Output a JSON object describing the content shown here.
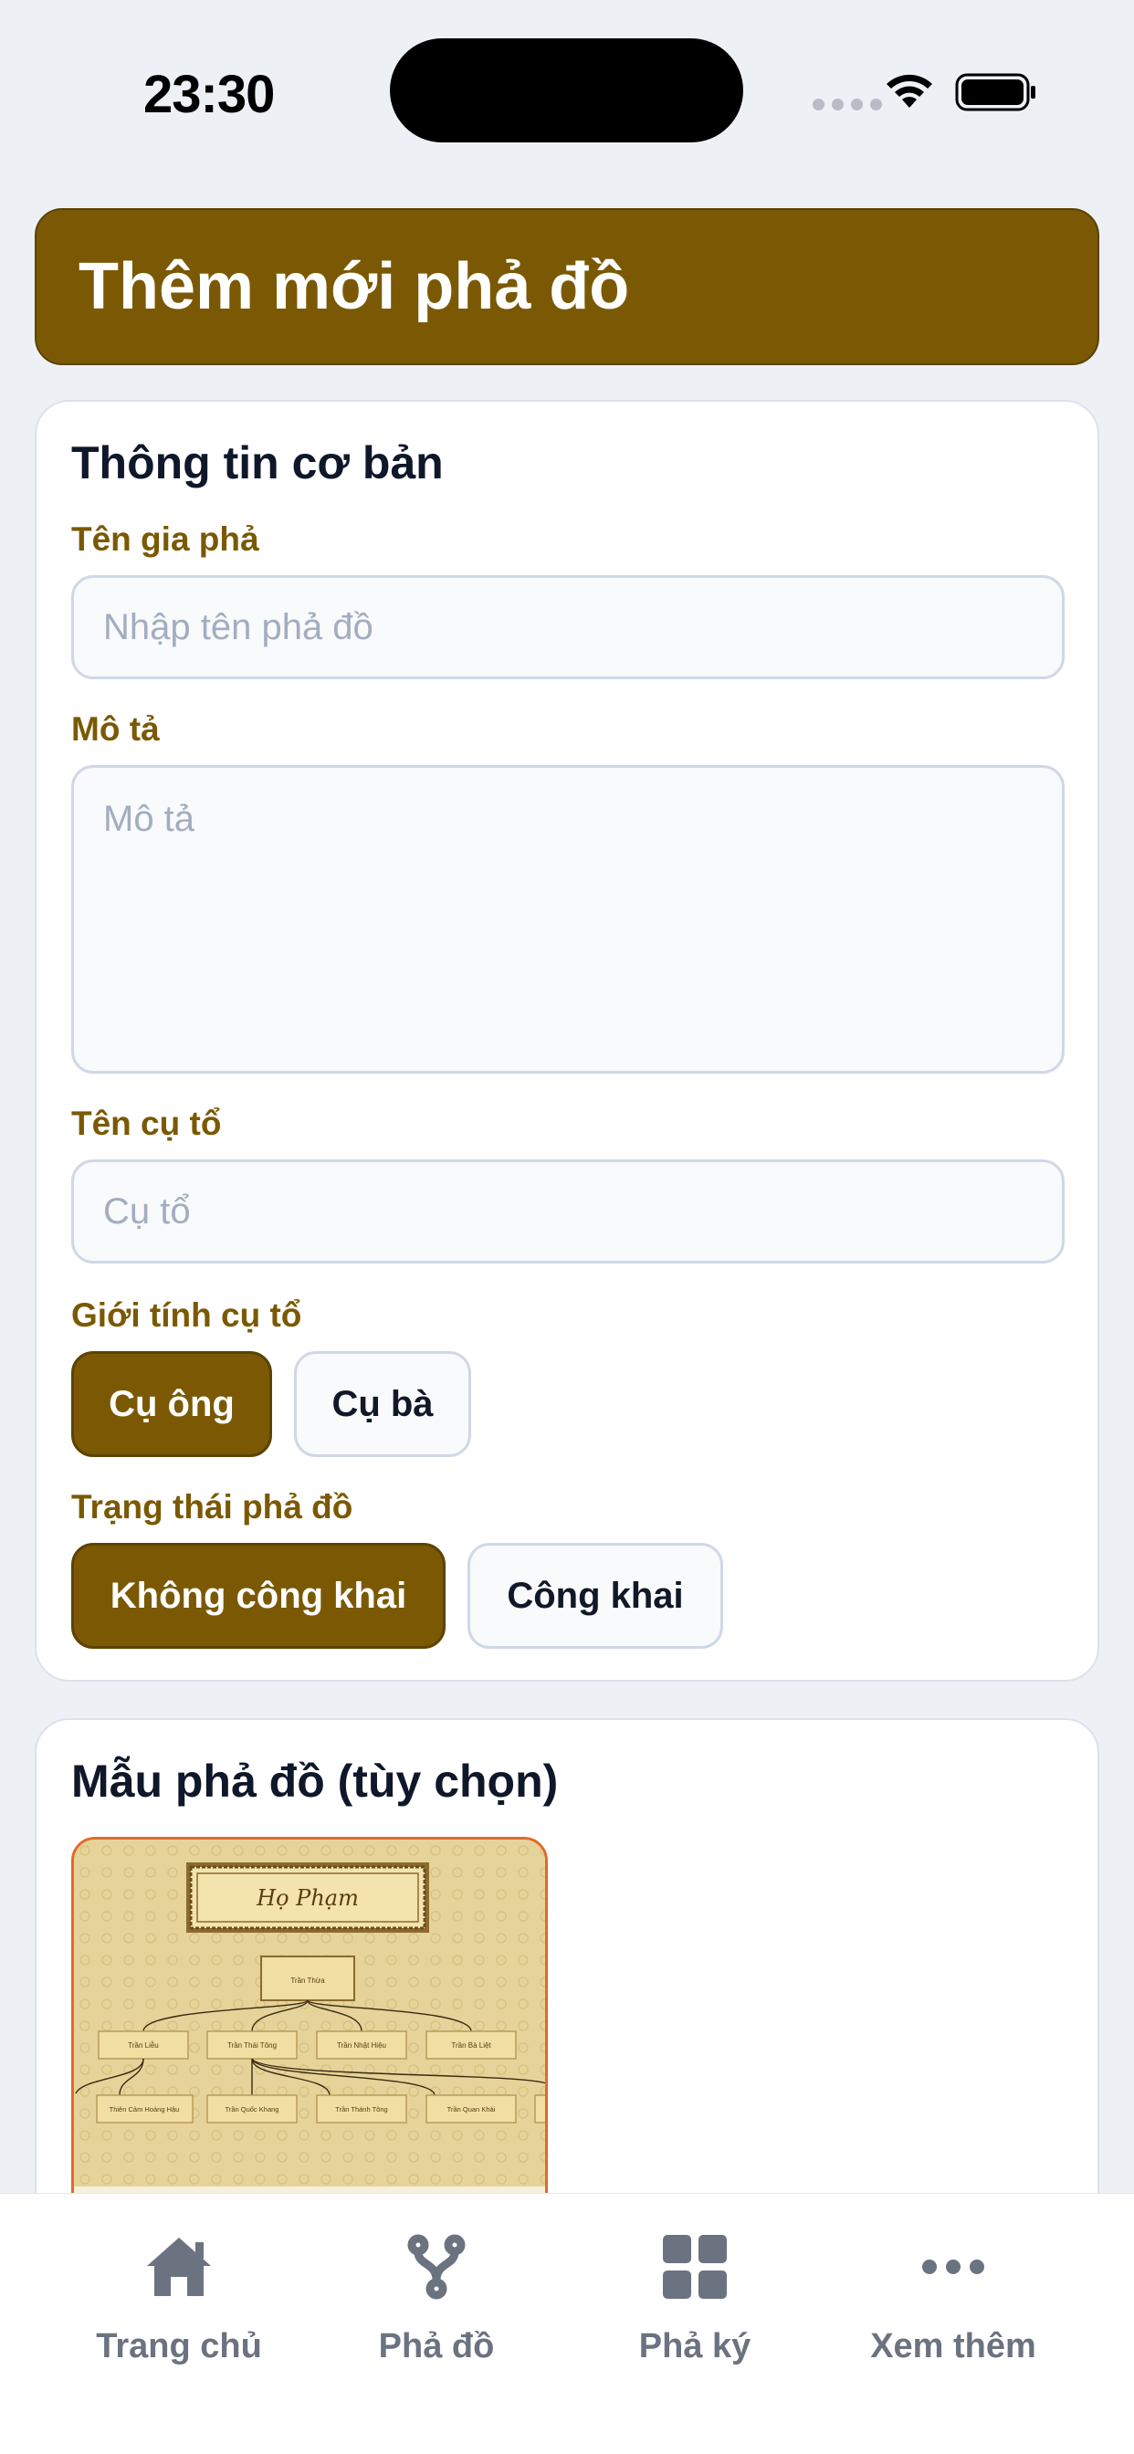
{
  "status": {
    "time": "23:30"
  },
  "header": {
    "title": "Thêm mới phả đồ"
  },
  "basic_info": {
    "title": "Thông tin cơ bản",
    "name_label": "Tên gia phả",
    "name_placeholder": "Nhập tên phả đồ",
    "desc_label": "Mô tả",
    "desc_placeholder": "Mô tả",
    "ancestor_label": "Tên cụ tổ",
    "ancestor_placeholder": "Cụ tổ",
    "gender_label": "Giới tính cụ tổ",
    "gender_options": [
      "Cụ ông",
      "Cụ bà"
    ],
    "gender_selected": "Cụ ông",
    "status_label": "Trạng thái phả đồ",
    "status_options": [
      "Không công khai",
      "Công khai"
    ],
    "status_selected": "Không công khai"
  },
  "templates": {
    "title": "Mẫu phả đồ (tùy chọn)",
    "preview": {
      "family_title": "Họ Phạm",
      "root": "Trần Thừa",
      "gen2": [
        "Trần Liễu",
        "Trần Thái Tông",
        "Trần Nhật Hiệu",
        "Trần Bà Liệt"
      ],
      "gen3": [
        "Thiên Cảm Hoàng Hậu",
        "Trần Quốc Khang",
        "Trần Thánh Tông",
        "Trần Quan Khải"
      ]
    }
  },
  "tabbar": {
    "items": [
      {
        "label": "Trang chủ",
        "icon": "home-icon"
      },
      {
        "label": "Phả đồ",
        "icon": "family-tree-icon"
      },
      {
        "label": "Phả ký",
        "icon": "grid-icon"
      },
      {
        "label": "Xem thêm",
        "icon": "more-icon"
      }
    ]
  },
  "colors": {
    "brand": "#7b5904",
    "background": "#edf1f6",
    "accent_border": "#e06a2a"
  }
}
